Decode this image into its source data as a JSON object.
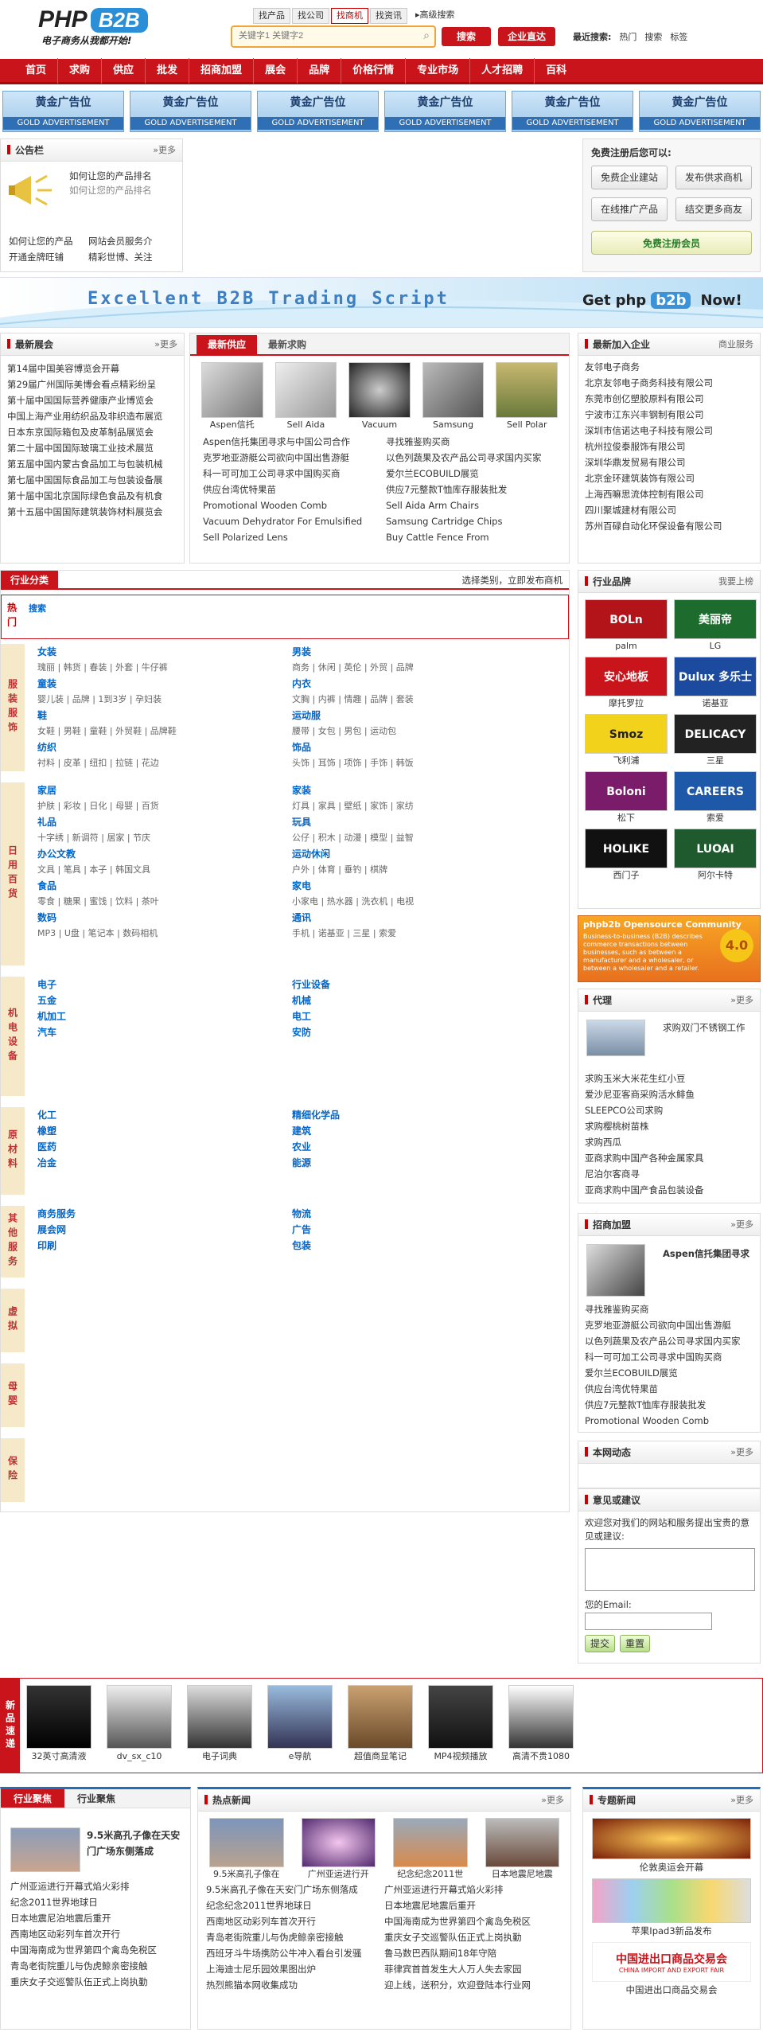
{
  "header": {
    "logo_php": "PHP",
    "logo_b2b": "B2B",
    "slogan": "电子商务从我都开始!",
    "search_tabs": [
      "找产品",
      "找公司",
      "找商机",
      "找资讯"
    ],
    "active_tab": 2,
    "adv_search": "高级搜索",
    "search_placeholder": "关键字1 关键字2",
    "search_btn": "搜索",
    "company_btn": "企业直达",
    "hot_label": "最近搜索:",
    "hot_items": [
      "热门",
      "搜索",
      "标签"
    ]
  },
  "nav": [
    "首页",
    "求购",
    "供应",
    "批发",
    "招商加盟",
    "展会",
    "品牌",
    "价格行情",
    "专业市场",
    "人才招聘",
    "百科"
  ],
  "ads": {
    "title": "黄金广告位",
    "sub": "GOLD ADVERTISEMENT"
  },
  "notice": {
    "title": "公告栏",
    "more": "»更多",
    "main": "如何让您的产品排名",
    "main2": "如何让您的产品排名",
    "items": [
      "如何让您的产品",
      "网站会员服务介",
      "开通金牌旺铺",
      "精彩世博、关注"
    ]
  },
  "reg": {
    "title": "免费注册后您可以:",
    "btns": [
      "免费企业建站",
      "发布供求商机",
      "在线推广产品",
      "结交更多商友"
    ],
    "join": "免费注册会员"
  },
  "banner": {
    "text": "Excellent B2B Trading Script",
    "get": "Get",
    "php": "php",
    "b2b": "b2b",
    "now": "Now!"
  },
  "expo": {
    "title": "最新展会",
    "more": "»更多",
    "items": [
      "第14届中国美容博览会开幕",
      "第29届广州国际美博会看点精彩纷呈",
      "第十届中国国际营养健康产业博览会",
      "中国上海产业用纺织品及非织造布展览",
      "日本东京国际箱包及皮革制品展览会",
      "第二十届中国国际玻璃工业技术展览",
      "第五届中国内蒙古食品加工与包装机械",
      "第七届中国国际食品加工与包装设备展",
      "第十届中国北京国际绿色食品及有机食",
      "第十五届中国国际建筑装饰材料展览会"
    ]
  },
  "supply": {
    "tabs": [
      "最新供应",
      "最新求购"
    ],
    "products": [
      "Aspen信托",
      "Sell Aida",
      "Vacuum",
      "Samsung",
      "Sell Polar"
    ],
    "left": [
      "Aspen信托集团寻求与中国公司合作",
      "克罗地亚游艇公司欲向中国出售游艇",
      "科一可可加工公司寻求中国购买商",
      "供应台湾优特果苗",
      "Promotional Wooden Comb",
      "Vacuum Dehydrator For Emulsified",
      "Sell Polarized Lens"
    ],
    "right": [
      "寻找雅鉴购买商",
      "以色列蔬果及农产品公司寻求国内买家",
      "爱尔兰ECOBUILD展览",
      "供应7元整款T恤库存服装批发",
      "Sell Aida Arm Chairs",
      "Samsung Cartridge Chips",
      "Buy Cattle Fence From"
    ]
  },
  "company": {
    "title": "最新加入企业",
    "more": "商业服务",
    "items": [
      "友邻电子商务",
      "北京友邻电子商务科技有限公司",
      "东莞市创亿塑胶原料有限公司",
      "宁波市江东兴丰钢制有限公司",
      "深圳市信诺达电子科技有限公司",
      "杭州拉俊泰服饰有限公司",
      "深圳华鼎发贸易有限公司",
      "北京金环建筑装饰有限公司",
      "上海西嘛思流体控制有限公司",
      "四川聚城建材有限公司",
      "苏州百碌自动化环保设备有限公司"
    ]
  },
  "category": {
    "title": "行业分类",
    "right": "选择类别，立即发布商机",
    "hot_side": "热门",
    "hot": "搜索",
    "groups": [
      {
        "side": "服装服饰",
        "cols": [
          [
            {
              "t": "女装",
              "i": "瑰丽 | 韩货 | 春装 | 外套 | 牛仔裤"
            },
            {
              "t": "童装",
              "i": "婴儿装 | 品牌 | 1到3岁 | 孕妇装"
            },
            {
              "t": "鞋",
              "i": "女鞋 | 男鞋 | 童鞋 | 外贸鞋 | 品牌鞋"
            },
            {
              "t": "纺织",
              "i": "衬料 | 皮革 | 纽扣 | 拉链 | 花边"
            }
          ],
          [
            {
              "t": "男装",
              "i": "商务 | 休闲 | 英伦 | 外贸 | 品牌"
            },
            {
              "t": "内衣",
              "i": "文胸 | 内裤 | 情趣 | 品牌 | 套装"
            },
            {
              "t": "运动服",
              "i": "腰带 | 女包 | 男包 | 运动包"
            },
            {
              "t": "饰品",
              "i": "头饰 | 耳饰 | 项饰 | 手饰 | 韩饭"
            }
          ]
        ]
      },
      {
        "side": "日用百货",
        "cols": [
          [
            {
              "t": "家居",
              "i": "护肤 | 彩妆 | 日化 | 母婴 | 百货"
            },
            {
              "t": "礼品",
              "i": "十字绣 | 新调符 | 居家 | 节庆"
            },
            {
              "t": "办公文教",
              "i": "文具 | 笔具 | 本子 | 韩国文具"
            },
            {
              "t": "食品",
              "i": "零食 | 糖果 | 蜜饯 | 饮料 | 茶叶"
            },
            {
              "t": "数码",
              "i": "MP3 | U盘 | 笔记本 | 数码相机"
            }
          ],
          [
            {
              "t": "家装",
              "i": "灯具 | 家具 | 壁纸 | 家饰 | 家纺"
            },
            {
              "t": "玩具",
              "i": "公仔 | 积木 | 动漫 | 模型 | 益智"
            },
            {
              "t": "运动休闲",
              "i": "户外 | 体育 | 垂钓 | 棋牌"
            },
            {
              "t": "家电",
              "i": "小家电 | 热水器 | 洗衣机 | 电视"
            },
            {
              "t": "通讯",
              "i": "手机 | 诺基亚 | 三星 | 索爱"
            }
          ]
        ]
      },
      {
        "side": "机电设备",
        "cols": [
          [
            {
              "t": "电子",
              "i": ""
            },
            {
              "t": "五金",
              "i": ""
            },
            {
              "t": "机加工",
              "i": ""
            },
            {
              "t": "汽车",
              "i": ""
            }
          ],
          [
            {
              "t": "行业设备",
              "i": ""
            },
            {
              "t": "机械",
              "i": ""
            },
            {
              "t": "电工",
              "i": ""
            },
            {
              "t": "安防",
              "i": ""
            }
          ]
        ]
      },
      {
        "side": "原材料",
        "cols": [
          [
            {
              "t": "化工",
              "i": ""
            },
            {
              "t": "橡塑",
              "i": ""
            },
            {
              "t": "医药",
              "i": ""
            },
            {
              "t": "冶金",
              "i": ""
            }
          ],
          [
            {
              "t": "精细化学品",
              "i": ""
            },
            {
              "t": "建筑",
              "i": ""
            },
            {
              "t": "农业",
              "i": ""
            },
            {
              "t": "能源",
              "i": ""
            }
          ]
        ]
      },
      {
        "side": "其他服务",
        "cols": [
          [
            {
              "t": "商务服务",
              "i": ""
            },
            {
              "t": "展会网",
              "i": ""
            },
            {
              "t": "印刷",
              "i": ""
            }
          ],
          [
            {
              "t": "物流",
              "i": ""
            },
            {
              "t": "广告",
              "i": ""
            },
            {
              "t": "包装",
              "i": ""
            }
          ]
        ]
      },
      {
        "side": "虚拟",
        "cols": [
          [],
          []
        ]
      },
      {
        "side": "母婴",
        "cols": [
          [],
          []
        ]
      },
      {
        "side": "保险",
        "cols": [
          [],
          []
        ]
      }
    ]
  },
  "brand": {
    "title": "行业品牌",
    "more": "我要上榜",
    "items": [
      "palm",
      "LG",
      "摩托罗拉",
      "诺基亚",
      "飞利浦",
      "三星",
      "松下",
      "索爱",
      "西门子",
      "阿尔卡特"
    ],
    "logos": [
      "BOLn",
      "美丽帝",
      "安心地板",
      "Dulux 多乐士",
      "Smoz",
      "DELICACY",
      "Boloni",
      "CAREERS",
      "HOLIKE",
      "LUOAI"
    ]
  },
  "forum": {
    "title": "phpb2b Opensource Community",
    "text": "Business-to-business (B2B) describes commerce transactions between businesses, such as between a manufacturer and a wholesaler, or between a wholesaler and a retailer.",
    "ver": "4.0"
  },
  "agent": {
    "title": "代理",
    "more": "»更多",
    "main": "求购双门不锈钢工作",
    "items": [
      "求购玉米大米花生红小豆",
      "爱沙尼亚客商采购活水鲱鱼",
      "SLEEPCO公司求购",
      "求购樱桃树苗株",
      "求购西瓜",
      "亚商求购中国产各种金属家具",
      "尼泊尔客商寻",
      "亚商求购中国产食品包装设备"
    ]
  },
  "invest": {
    "title": "招商加盟",
    "more": "»更多",
    "main": "Aspen信托集团寻求",
    "items": [
      "寻找雅鉴购买商",
      "克罗地亚游艇公司欲向中国出售游艇",
      "以色列蔬果及农产品公司寻求国内买家",
      "科一可可加工公司寻求中国购买商",
      "爱尔兰ECOBUILD展览",
      "供应台湾优特果苗",
      "供应7元整款T恤库存服装批发",
      "Promotional Wooden Comb"
    ]
  },
  "news_block": {
    "title": "本网动态",
    "more": "»更多"
  },
  "feedback": {
    "title": "意见或建议",
    "text": "欢迎您对我们的网站和服务提出宝贵的意见或建议:",
    "email": "您的Email:",
    "submit": "提交",
    "reset": "重置"
  },
  "newgoods": {
    "side": "新品速递",
    "items": [
      "32英寸高清液",
      "dv_sx_c10",
      "电子词典",
      "e导航",
      "超值商显笔记",
      "MP4视频播放",
      "高清不贵1080"
    ]
  },
  "industry": {
    "tabs": [
      "行业聚焦",
      "行业聚焦"
    ],
    "main": "9.5米高孔子像在天安门广场东侧落成",
    "items": [
      "广州亚运进行开幕式焰火彩排",
      "纪念2011世界地球日",
      "日本地震尼泊地震后重开",
      "西南地区动彩列车首次开行",
      "中国海南成为世界第四个禽岛免税区",
      "青岛老街院重儿与伪虎鲸亲密接触",
      "重庆女子交巡警队伍正式上岗执勤"
    ]
  },
  "hotnews": {
    "title": "热点新闻",
    "more": "»更多",
    "pics": [
      "9.5米高孔子像在",
      "广州亚运进行开",
      "纪念纪念2011世",
      "日本地震尼地震"
    ],
    "left": [
      "9.5米高孔子像在天安门广场东侧落成",
      "纪念纪念2011世界地球日",
      "西南地区动彩列车首次开行",
      "青岛老街院重儿与伪虎鲸亲密接触",
      "西班牙斗牛场携防公牛冲入看台引发骚",
      "上海迪士尼乐园效果图出炉",
      "热烈熊猫本网收集成功"
    ],
    "right": [
      "广州亚运进行开幕式焰火彩排",
      "日本地震尼地震后重开",
      "中国海南成为世界第四个禽岛免税区",
      "重庆女子交巡警队伍正式上岗执勤",
      "鲁马数巴西队期间18年守陪",
      "菲律宾首首发生大人万人失去家园",
      "迎上线，送积分，欢迎登陆本行业网"
    ]
  },
  "special": {
    "title": "专题新闻",
    "more": "»更多",
    "items": [
      "伦敦奥运会开幕",
      "苹果Ipad3新品发布",
      "中国进出口商品交易会"
    ],
    "expo_text": "中国进出口商品交易会",
    "expo_en": "CHINA IMPORT AND EXPORT FAIR"
  }
}
